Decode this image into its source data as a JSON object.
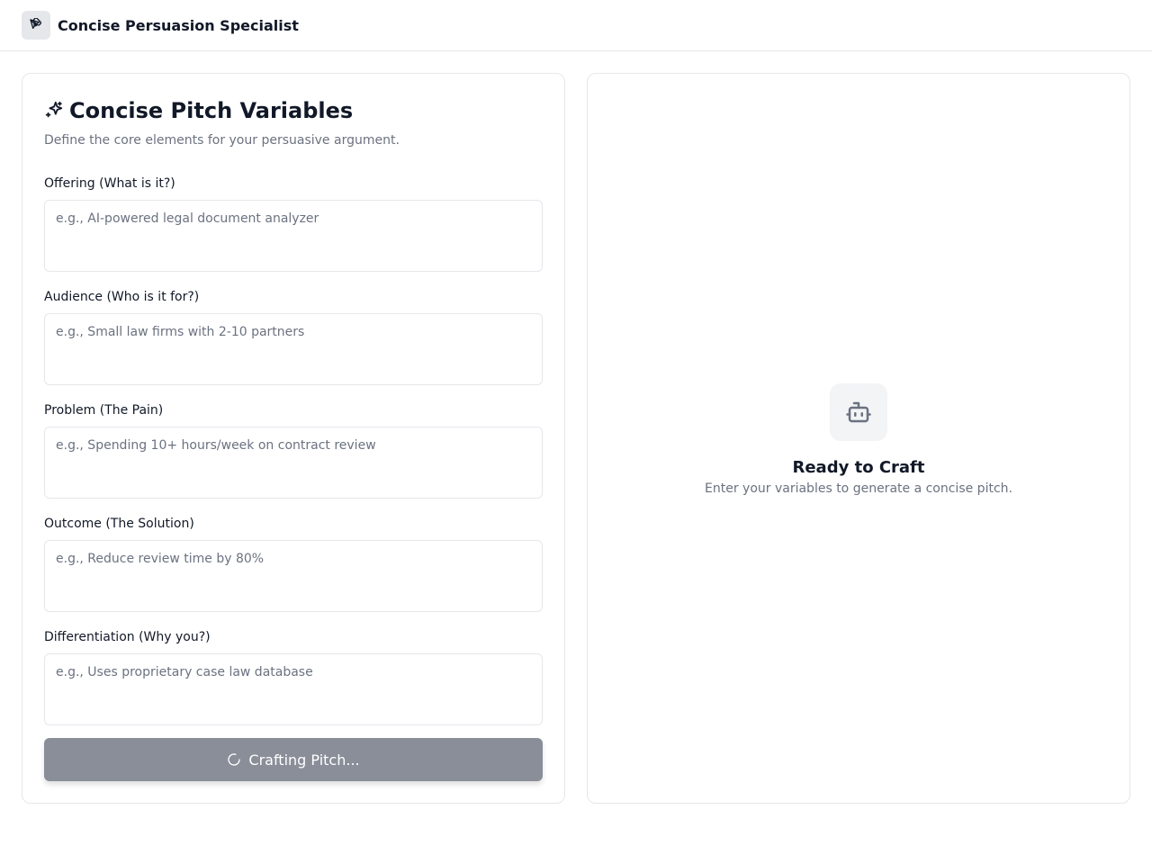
{
  "header": {
    "title": "Concise Persuasion Specialist",
    "logo_icon": "pen-tool-icon"
  },
  "form": {
    "title": "Concise Pitch Variables",
    "title_icon": "sparkles-icon",
    "subtitle": "Define the core elements for your persuasive argument.",
    "fields": [
      {
        "label": "Offering (What is it?)",
        "placeholder": "e.g., AI-powered legal document analyzer",
        "value": ""
      },
      {
        "label": "Audience (Who is it for?)",
        "placeholder": "e.g., Small law firms with 2-10 partners",
        "value": ""
      },
      {
        "label": "Problem (The Pain)",
        "placeholder": "e.g., Spending 10+ hours/week on contract review",
        "value": ""
      },
      {
        "label": "Outcome (The Solution)",
        "placeholder": "e.g., Reduce review time by 80%",
        "value": ""
      },
      {
        "label": "Differentiation (Why you?)",
        "placeholder": "e.g., Uses proprietary case law database",
        "value": ""
      }
    ],
    "submit_label": "Crafting Pitch...",
    "submit_icon": "loader-spinner-icon"
  },
  "output": {
    "icon": "bot-icon",
    "title": "Ready to Craft",
    "subtitle": "Enter your variables to generate a concise pitch."
  },
  "colors": {
    "button_disabled": "#898e99",
    "border": "#e5e7eb",
    "muted_text": "#6b7280",
    "heading_text": "#111827"
  }
}
